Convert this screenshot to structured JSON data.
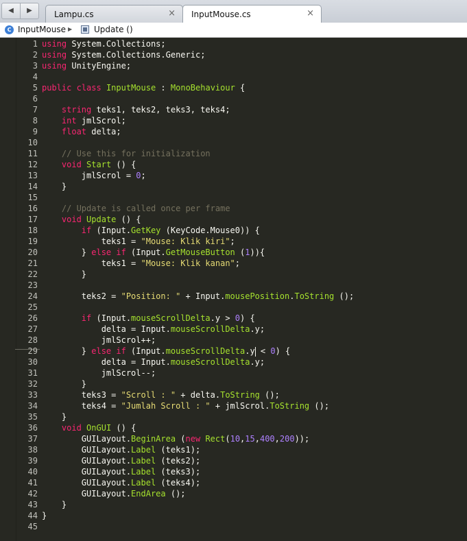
{
  "tabs": [
    {
      "label": "Lampu.cs",
      "close": "×"
    },
    {
      "label": "InputMouse.cs",
      "close": "×"
    }
  ],
  "nav": {
    "back": "◀",
    "forward": "▶"
  },
  "breadcrumb": {
    "class_name": "InputMouse",
    "separator": "▶",
    "method_name": "Update ()"
  },
  "colors": {
    "editor_bg": "#272822",
    "keyword": "#f92672",
    "type": "#66d9ef",
    "function": "#a6e22e",
    "string": "#e6db74",
    "number": "#ae81ff",
    "comment": "#75715e"
  },
  "cursor": {
    "line": 29
  },
  "code_lines": [
    [
      [
        "kw",
        "using"
      ],
      [
        "pl",
        " System.Collections;"
      ]
    ],
    [
      [
        "kw",
        "using"
      ],
      [
        "pl",
        " System.Collections.Generic;"
      ]
    ],
    [
      [
        "kw",
        "using"
      ],
      [
        "pl",
        " UnityEngine;"
      ]
    ],
    [],
    [
      [
        "kw",
        "public"
      ],
      [
        "pl",
        " "
      ],
      [
        "kw",
        "class"
      ],
      [
        "pl",
        " "
      ],
      [
        "cls",
        "InputMouse"
      ],
      [
        "pl",
        " : "
      ],
      [
        "cls",
        "MonoBehaviour"
      ],
      [
        "pl",
        " {"
      ]
    ],
    [],
    [
      [
        "pl",
        "    "
      ],
      [
        "kw",
        "string"
      ],
      [
        "pl",
        " teks1, teks2, teks3, teks4;"
      ]
    ],
    [
      [
        "pl",
        "    "
      ],
      [
        "kw",
        "int"
      ],
      [
        "pl",
        " jmlScrol;"
      ]
    ],
    [
      [
        "pl",
        "    "
      ],
      [
        "kw",
        "float"
      ],
      [
        "pl",
        " delta;"
      ]
    ],
    [],
    [
      [
        "pl",
        "    "
      ],
      [
        "cm",
        "// Use this for initialization"
      ]
    ],
    [
      [
        "pl",
        "    "
      ],
      [
        "kw",
        "void"
      ],
      [
        "pl",
        " "
      ],
      [
        "fn",
        "Start"
      ],
      [
        "pl",
        " () {"
      ]
    ],
    [
      [
        "pl",
        "        jmlScrol = "
      ],
      [
        "num",
        "0"
      ],
      [
        "pl",
        ";"
      ]
    ],
    [
      [
        "pl",
        "    }"
      ]
    ],
    [],
    [
      [
        "pl",
        "    "
      ],
      [
        "cm",
        "// Update is called once per frame"
      ]
    ],
    [
      [
        "pl",
        "    "
      ],
      [
        "kw",
        "void"
      ],
      [
        "pl",
        " "
      ],
      [
        "fn",
        "Update"
      ],
      [
        "pl",
        " () {"
      ]
    ],
    [
      [
        "pl",
        "        "
      ],
      [
        "kw",
        "if"
      ],
      [
        "pl",
        " (Input."
      ],
      [
        "fn",
        "GetKey"
      ],
      [
        "pl",
        " (KeyCode.Mouse0)) {"
      ]
    ],
    [
      [
        "pl",
        "            teks1 = "
      ],
      [
        "str",
        "\"Mouse: Klik kiri\""
      ],
      [
        "pl",
        ";"
      ]
    ],
    [
      [
        "pl",
        "        } "
      ],
      [
        "kw",
        "else if"
      ],
      [
        "pl",
        " (Input."
      ],
      [
        "fn",
        "GetMouseButton"
      ],
      [
        "pl",
        " ("
      ],
      [
        "num",
        "1"
      ],
      [
        "pl",
        ")){"
      ]
    ],
    [
      [
        "pl",
        "            teks1 = "
      ],
      [
        "str",
        "\"Mouse: Klik kanan\""
      ],
      [
        "pl",
        ";"
      ]
    ],
    [
      [
        "pl",
        "        }"
      ]
    ],
    [],
    [
      [
        "pl",
        "        teks2 = "
      ],
      [
        "str",
        "\"Position: \""
      ],
      [
        "pl",
        " + Input."
      ],
      [
        "fn",
        "mousePosition"
      ],
      [
        "pl",
        "."
      ],
      [
        "fn",
        "ToString"
      ],
      [
        "pl",
        " ();"
      ]
    ],
    [],
    [
      [
        "pl",
        "        "
      ],
      [
        "kw",
        "if"
      ],
      [
        "pl",
        " (Input."
      ],
      [
        "fn",
        "mouseScrollDelta"
      ],
      [
        "pl",
        ".y > "
      ],
      [
        "num",
        "0"
      ],
      [
        "pl",
        ") {"
      ]
    ],
    [
      [
        "pl",
        "            delta = Input."
      ],
      [
        "fn",
        "mouseScrollDelta"
      ],
      [
        "pl",
        ".y;"
      ]
    ],
    [
      [
        "pl",
        "            jmlScrol++;"
      ]
    ],
    [
      [
        "pl",
        "        } "
      ],
      [
        "kw",
        "else if"
      ],
      [
        "pl",
        " (Input."
      ],
      [
        "fn",
        "mouseScrollDelta"
      ],
      [
        "pl",
        ".y"
      ],
      [
        "cursor",
        ""
      ],
      [
        "pl",
        " < "
      ],
      [
        "num",
        "0"
      ],
      [
        "pl",
        ") {"
      ]
    ],
    [
      [
        "pl",
        "            delta = Input."
      ],
      [
        "fn",
        "mouseScrollDelta"
      ],
      [
        "pl",
        ".y;"
      ]
    ],
    [
      [
        "pl",
        "            jmlScrol--;"
      ]
    ],
    [
      [
        "pl",
        "        }"
      ]
    ],
    [
      [
        "pl",
        "        teks3 = "
      ],
      [
        "str",
        "\"Scroll : \""
      ],
      [
        "pl",
        " + delta."
      ],
      [
        "fn",
        "ToString"
      ],
      [
        "pl",
        " ();"
      ]
    ],
    [
      [
        "pl",
        "        teks4 = "
      ],
      [
        "str",
        "\"Jumlah Scroll : \""
      ],
      [
        "pl",
        " + jmlScrol."
      ],
      [
        "fn",
        "ToString"
      ],
      [
        "pl",
        " ();"
      ]
    ],
    [
      [
        "pl",
        "    }"
      ]
    ],
    [
      [
        "pl",
        "    "
      ],
      [
        "kw",
        "void"
      ],
      [
        "pl",
        " "
      ],
      [
        "fn",
        "OnGUI"
      ],
      [
        "pl",
        " () {"
      ]
    ],
    [
      [
        "pl",
        "        GUILayout."
      ],
      [
        "fn",
        "BeginArea"
      ],
      [
        "pl",
        " ("
      ],
      [
        "kw",
        "new"
      ],
      [
        "pl",
        " "
      ],
      [
        "fn",
        "Rect"
      ],
      [
        "pl",
        "("
      ],
      [
        "num",
        "10"
      ],
      [
        "pl",
        ","
      ],
      [
        "num",
        "15"
      ],
      [
        "pl",
        ","
      ],
      [
        "num",
        "400"
      ],
      [
        "pl",
        ","
      ],
      [
        "num",
        "200"
      ],
      [
        "pl",
        "));"
      ]
    ],
    [
      [
        "pl",
        "        GUILayout."
      ],
      [
        "fn",
        "Label"
      ],
      [
        "pl",
        " (teks1);"
      ]
    ],
    [
      [
        "pl",
        "        GUILayout."
      ],
      [
        "fn",
        "Label"
      ],
      [
        "pl",
        " (teks2);"
      ]
    ],
    [
      [
        "pl",
        "        GUILayout."
      ],
      [
        "fn",
        "Label"
      ],
      [
        "pl",
        " (teks3);"
      ]
    ],
    [
      [
        "pl",
        "        GUILayout."
      ],
      [
        "fn",
        "Label"
      ],
      [
        "pl",
        " (teks4);"
      ]
    ],
    [
      [
        "pl",
        "        GUILayout."
      ],
      [
        "fn",
        "EndArea"
      ],
      [
        "pl",
        " ();"
      ]
    ],
    [
      [
        "pl",
        "    }"
      ]
    ],
    [
      [
        "pl",
        "}"
      ]
    ],
    []
  ]
}
